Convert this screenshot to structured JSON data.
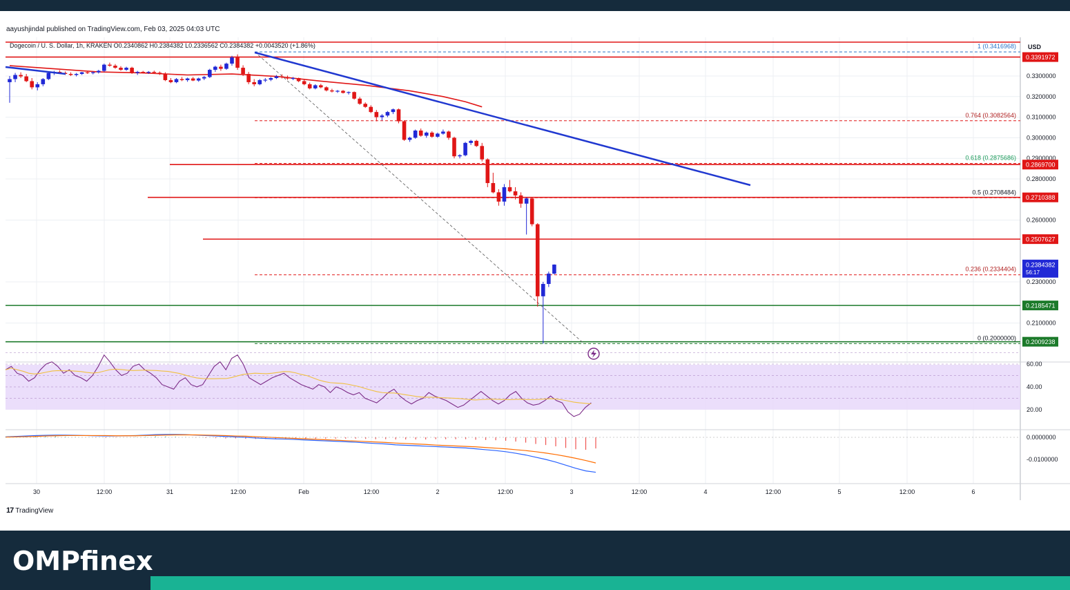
{
  "publisher_line": "aayushjindal published on TradingView.com, Feb 03, 2025 04:03 UTC",
  "ohlc_line": "Dogecoin / U. S. Dollar, 1h, KRAKEN  O0.2340862  H0.2384382  L0.2336562  C0.2384382  +0.0043520 (+1.86%)",
  "currency": "USD",
  "tradingview_label": "TradingView",
  "brand": "OMPfinex",
  "colors": {
    "up": "#2129d6",
    "down": "#e01616",
    "ma": "#e01616",
    "trendline": "#2038d0",
    "support": "#1b7a2a",
    "rsi": "#7b2a86",
    "rsi_ma": "#f0c040",
    "macd": "#2962ff",
    "signal": "#ff6d00"
  },
  "chart_data": {
    "type": "candlestick",
    "symbol": "Dogecoin / U. S. Dollar",
    "interval": "1h",
    "exchange": "KRAKEN",
    "ohlc": {
      "open": 0.2340862,
      "high": 0.2384382,
      "low": 0.2336562,
      "close": 0.2384382,
      "change": 0.004352,
      "change_pct": 1.86
    },
    "price_ticks": [
      "0.3300000",
      "0.3200000",
      "0.3100000",
      "0.3000000",
      "0.2900000",
      "0.2800000",
      "0.2600000",
      "0.2300000",
      "0.2100000"
    ],
    "x_ticks": [
      "30",
      "12:00",
      "31",
      "12:00",
      "Feb",
      "12:00",
      "2",
      "12:00",
      "3",
      "12:00",
      "4",
      "12:00",
      "5",
      "12:00",
      "6"
    ],
    "price_labels": [
      {
        "label": "0.3391972",
        "value": 0.3391972,
        "color": "#e01616"
      },
      {
        "label": "0.2869700",
        "value": 0.28697,
        "color": "#e01616"
      },
      {
        "label": "0.2710388",
        "value": 0.2710388,
        "color": "#e01616"
      },
      {
        "label": "0.2507627",
        "value": 0.2507627,
        "color": "#e01616"
      },
      {
        "label": "0.2185471",
        "value": 0.2185471,
        "color": "#1b7a2a"
      },
      {
        "label": "0.2009238",
        "value": 0.2009238,
        "color": "#1b7a2a"
      }
    ],
    "current_price": {
      "label": "0.2384382",
      "timer": "56:17"
    },
    "fibonacci": [
      {
        "label": "1 (0.3416968)",
        "value": 0.3416968,
        "color": "#2a74c8"
      },
      {
        "label": "0.764 (0.3082564)",
        "value": 0.3082564,
        "color": "#b02020"
      },
      {
        "label": "0.618 (0.2875686)",
        "value": 0.2875686,
        "color": "#1a9a5a"
      },
      {
        "label": "0.5 (0.2708484)",
        "value": 0.2708484,
        "color": "#131722"
      },
      {
        "label": "0.236 (0.2334404)",
        "value": 0.2334404,
        "color": "#b02020"
      },
      {
        "label": "0 (0.2000000)",
        "value": 0.2,
        "color": "#131722"
      }
    ],
    "candles": [
      [
        0.327,
        0.33,
        0.317,
        0.3285
      ],
      [
        0.3285,
        0.3315,
        0.327,
        0.3305
      ],
      [
        0.3305,
        0.3318,
        0.329,
        0.3298
      ],
      [
        0.3298,
        0.331,
        0.327,
        0.3275
      ],
      [
        0.3275,
        0.329,
        0.3235,
        0.3245
      ],
      [
        0.3245,
        0.327,
        0.323,
        0.326
      ],
      [
        0.326,
        0.329,
        0.325,
        0.3285
      ],
      [
        0.3285,
        0.332,
        0.328,
        0.3315
      ],
      [
        0.3315,
        0.3325,
        0.3305,
        0.332
      ],
      [
        0.332,
        0.3328,
        0.331,
        0.3315
      ],
      [
        0.3315,
        0.3322,
        0.3305,
        0.331
      ],
      [
        0.331,
        0.3318,
        0.33,
        0.3305
      ],
      [
        0.3305,
        0.3315,
        0.3298,
        0.331
      ],
      [
        0.331,
        0.332,
        0.3305,
        0.3318
      ],
      [
        0.3318,
        0.3325,
        0.331,
        0.3315
      ],
      [
        0.3315,
        0.3322,
        0.3308,
        0.3318
      ],
      [
        0.3318,
        0.333,
        0.3312,
        0.3325
      ],
      [
        0.3325,
        0.336,
        0.332,
        0.3355
      ],
      [
        0.3355,
        0.3365,
        0.3345,
        0.335
      ],
      [
        0.335,
        0.3358,
        0.3335,
        0.334
      ],
      [
        0.334,
        0.3348,
        0.3325,
        0.333
      ],
      [
        0.333,
        0.3345,
        0.3325,
        0.334
      ],
      [
        0.334,
        0.3345,
        0.331,
        0.3315
      ],
      [
        0.3315,
        0.3325,
        0.3305,
        0.332
      ],
      [
        0.332,
        0.3325,
        0.3312,
        0.3316
      ],
      [
        0.3316,
        0.3324,
        0.331,
        0.332
      ],
      [
        0.332,
        0.3326,
        0.3312,
        0.3316
      ],
      [
        0.3316,
        0.3322,
        0.3305,
        0.331
      ],
      [
        0.331,
        0.3318,
        0.3275,
        0.328
      ],
      [
        0.328,
        0.329,
        0.3265,
        0.327
      ],
      [
        0.327,
        0.329,
        0.3265,
        0.3285
      ],
      [
        0.3285,
        0.3295,
        0.3275,
        0.328
      ],
      [
        0.328,
        0.3292,
        0.3272,
        0.3288
      ],
      [
        0.3288,
        0.3295,
        0.3275,
        0.3278
      ],
      [
        0.3278,
        0.3292,
        0.3272,
        0.3288
      ],
      [
        0.3288,
        0.33,
        0.328,
        0.3295
      ],
      [
        0.3295,
        0.3335,
        0.329,
        0.333
      ],
      [
        0.333,
        0.335,
        0.332,
        0.3345
      ],
      [
        0.3345,
        0.3355,
        0.3325,
        0.3335
      ],
      [
        0.3335,
        0.3365,
        0.333,
        0.336
      ],
      [
        0.336,
        0.3398,
        0.335,
        0.339
      ],
      [
        0.339,
        0.3405,
        0.333,
        0.334
      ],
      [
        0.334,
        0.3352,
        0.33,
        0.331
      ],
      [
        0.331,
        0.332,
        0.326,
        0.327
      ],
      [
        0.327,
        0.3285,
        0.325,
        0.326
      ],
      [
        0.326,
        0.3285,
        0.3255,
        0.328
      ],
      [
        0.328,
        0.329,
        0.327,
        0.3282
      ],
      [
        0.3282,
        0.3295,
        0.3275,
        0.329
      ],
      [
        0.329,
        0.3305,
        0.3285,
        0.3298
      ],
      [
        0.3298,
        0.3308,
        0.3288,
        0.3295
      ],
      [
        0.3295,
        0.3302,
        0.3282,
        0.3288
      ],
      [
        0.3288,
        0.3295,
        0.328,
        0.329
      ],
      [
        0.329,
        0.3292,
        0.327,
        0.3275
      ],
      [
        0.3275,
        0.3282,
        0.3255,
        0.326
      ],
      [
        0.326,
        0.3268,
        0.3235,
        0.324
      ],
      [
        0.324,
        0.326,
        0.3235,
        0.3255
      ],
      [
        0.3255,
        0.3262,
        0.324,
        0.3245
      ],
      [
        0.3245,
        0.325,
        0.3225,
        0.323
      ],
      [
        0.323,
        0.3238,
        0.322,
        0.3225
      ],
      [
        0.3225,
        0.3232,
        0.3218,
        0.3228
      ],
      [
        0.3228,
        0.3232,
        0.3215,
        0.3218
      ],
      [
        0.3218,
        0.3225,
        0.321,
        0.3222
      ],
      [
        0.3222,
        0.3225,
        0.3185,
        0.319
      ],
      [
        0.319,
        0.3198,
        0.316,
        0.3165
      ],
      [
        0.3165,
        0.3172,
        0.3145,
        0.315
      ],
      [
        0.315,
        0.3158,
        0.312,
        0.3125
      ],
      [
        0.3125,
        0.3135,
        0.308,
        0.31
      ],
      [
        0.31,
        0.3115,
        0.3085,
        0.3108
      ],
      [
        0.3108,
        0.313,
        0.31,
        0.3125
      ],
      [
        0.3125,
        0.3142,
        0.3115,
        0.3138
      ],
      [
        0.3138,
        0.3142,
        0.307,
        0.308
      ],
      [
        0.308,
        0.3085,
        0.2985,
        0.299
      ],
      [
        0.299,
        0.3005,
        0.298,
        0.3
      ],
      [
        0.3,
        0.304,
        0.2995,
        0.3035
      ],
      [
        0.3035,
        0.3045,
        0.3005,
        0.301
      ],
      [
        0.301,
        0.303,
        0.3,
        0.3025
      ],
      [
        0.3025,
        0.3032,
        0.3,
        0.3005
      ],
      [
        0.3005,
        0.3025,
        0.3,
        0.302
      ],
      [
        0.302,
        0.304,
        0.3015,
        0.303
      ],
      [
        0.303,
        0.3035,
        0.299,
        0.3
      ],
      [
        0.3,
        0.3005,
        0.29,
        0.291
      ],
      [
        0.291,
        0.292,
        0.29,
        0.2915
      ],
      [
        0.2915,
        0.298,
        0.291,
        0.2975
      ],
      [
        0.2975,
        0.299,
        0.2965,
        0.2985
      ],
      [
        0.2985,
        0.299,
        0.2955,
        0.296
      ],
      [
        0.296,
        0.2975,
        0.2885,
        0.2895
      ],
      [
        0.2895,
        0.29,
        0.276,
        0.278
      ],
      [
        0.278,
        0.283,
        0.273,
        0.2735
      ],
      [
        0.2735,
        0.275,
        0.267,
        0.269
      ],
      [
        0.269,
        0.2775,
        0.267,
        0.276
      ],
      [
        0.276,
        0.2795,
        0.2735,
        0.274
      ],
      [
        0.274,
        0.276,
        0.27,
        0.272
      ],
      [
        0.272,
        0.2735,
        0.266,
        0.268
      ],
      [
        0.268,
        0.271,
        0.253,
        0.2705
      ],
      [
        0.2705,
        0.2712,
        0.257,
        0.258
      ],
      [
        0.258,
        0.2585,
        0.218,
        0.223
      ],
      [
        0.223,
        0.23,
        0.2,
        0.229
      ],
      [
        0.229,
        0.235,
        0.2275,
        0.234
      ],
      [
        0.234,
        0.2385,
        0.2336,
        0.2384
      ]
    ],
    "ma_line": [
      [
        0,
        0.335
      ],
      [
        8,
        0.3335
      ],
      [
        16,
        0.332
      ],
      [
        24,
        0.3315
      ],
      [
        32,
        0.3305
      ],
      [
        40,
        0.331
      ],
      [
        48,
        0.3298
      ],
      [
        56,
        0.3275
      ],
      [
        64,
        0.3255
      ],
      [
        72,
        0.3228
      ],
      [
        78,
        0.32
      ],
      [
        82,
        0.3175
      ],
      [
        85,
        0.315
      ]
    ],
    "trendline": {
      "start": [
        0,
        0.3345
      ],
      "mid": [
        39.7,
        0.34
      ],
      "end": [
        110,
        0.2774
      ],
      "pre_segment": [
        [
          0,
          0.3345
        ],
        [
          10,
          0.3325
        ]
      ]
    },
    "support_levels": [
      0.2185471,
      0.2009238
    ],
    "rsi": {
      "levels": [
        70,
        60,
        50,
        40,
        30
      ],
      "ticks": [
        "60.00",
        "40.00",
        "20.00"
      ],
      "values": [
        55,
        58,
        52,
        50,
        45,
        48,
        55,
        60,
        62,
        58,
        52,
        55,
        50,
        48,
        45,
        50,
        58,
        68,
        62,
        55,
        50,
        52,
        58,
        60,
        55,
        52,
        48,
        42,
        40,
        38,
        45,
        48,
        42,
        40,
        42,
        50,
        58,
        62,
        55,
        65,
        68,
        60,
        48,
        45,
        42,
        45,
        48,
        50,
        52,
        48,
        45,
        42,
        40,
        38,
        42,
        40,
        35,
        40,
        38,
        35,
        33,
        35,
        30,
        28,
        26,
        30,
        35,
        38,
        32,
        28,
        25,
        28,
        30,
        35,
        32,
        30,
        28,
        25,
        22,
        24,
        28,
        32,
        36,
        32,
        28,
        25,
        28,
        33,
        36,
        30,
        26,
        24,
        25,
        28,
        32,
        28,
        26,
        18,
        14,
        16,
        22,
        26
      ]
    },
    "macd": {
      "ticks": [
        "0.0000000",
        "-0.0100000"
      ],
      "macd": [
        0.0002,
        0.0004,
        0.0006,
        0.0008,
        0.0009,
        0.001,
        0.001,
        0.0009,
        0.0008,
        0.0007,
        0.0006,
        0.0006,
        0.0007,
        0.0008,
        0.001,
        0.0012,
        0.0013,
        0.0013,
        0.0012,
        0.001,
        0.0008,
        0.0006,
        0.0004,
        0.0002,
        0.0,
        -0.0003,
        -0.0005,
        -0.0007,
        -0.0008,
        -0.001,
        -0.0012,
        -0.0014,
        -0.0016,
        -0.0018,
        -0.002,
        -0.0022,
        -0.0025,
        -0.0028,
        -0.003,
        -0.0034,
        -0.0036,
        -0.0038,
        -0.004,
        -0.0042,
        -0.0044,
        -0.0046,
        -0.0048,
        -0.0052,
        -0.0056,
        -0.006,
        -0.0065,
        -0.0072,
        -0.008,
        -0.009,
        -0.01,
        -0.0112,
        -0.0126,
        -0.014,
        -0.0152,
        -0.0158
      ],
      "signal": [
        0.0001,
        0.0002,
        0.0003,
        0.0004,
        0.0006,
        0.0007,
        0.0008,
        0.0008,
        0.0008,
        0.0008,
        0.0008,
        0.0007,
        0.0007,
        0.0007,
        0.0008,
        0.0009,
        0.001,
        0.0011,
        0.0011,
        0.0011,
        0.001,
        0.0009,
        0.0008,
        0.0006,
        0.0005,
        0.0003,
        0.0001,
        -0.0001,
        -0.0003,
        -0.0005,
        -0.0007,
        -0.0009,
        -0.0011,
        -0.0013,
        -0.0015,
        -0.0017,
        -0.0019,
        -0.0021,
        -0.0023,
        -0.0026,
        -0.0028,
        -0.003,
        -0.0032,
        -0.0035,
        -0.0037,
        -0.0039,
        -0.0041,
        -0.0043,
        -0.0046,
        -0.0049,
        -0.0052,
        -0.0056,
        -0.006,
        -0.0065,
        -0.0071,
        -0.0078,
        -0.0086,
        -0.0095,
        -0.0105,
        -0.0116
      ]
    }
  }
}
